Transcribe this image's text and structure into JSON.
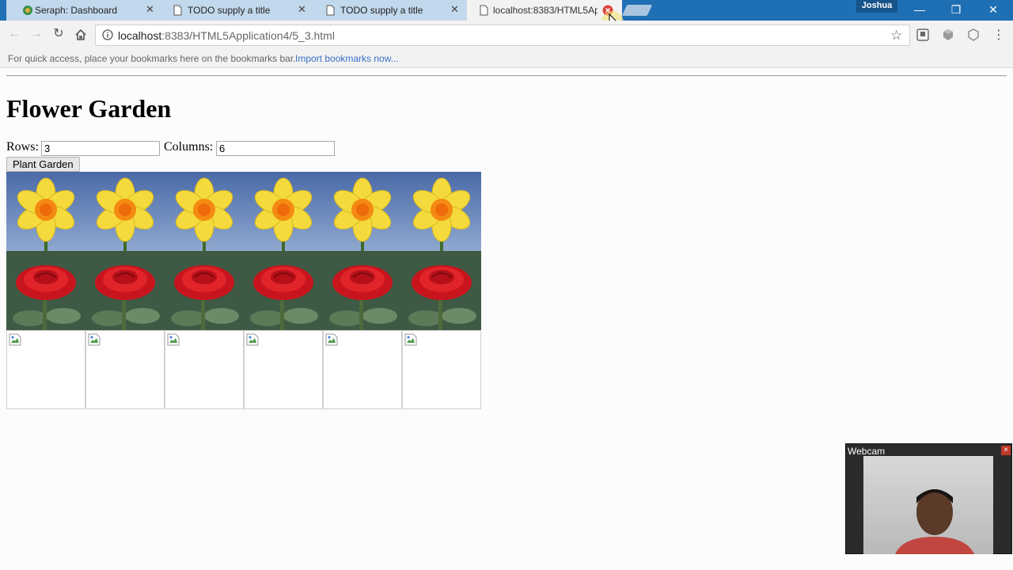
{
  "browser": {
    "tabs": [
      {
        "title": "Seraph: Dashboard",
        "active": false
      },
      {
        "title": "TODO supply a title",
        "active": false
      },
      {
        "title": "TODO supply a title",
        "active": false
      },
      {
        "title": "localhost:8383/HTML5Ap",
        "active": true
      }
    ],
    "profile_name": "Joshua",
    "url_host": "localhost",
    "url_rest": ":8383/HTML5Application4/5_3.html",
    "bookmarks_hint": "For quick access, place your bookmarks here on the bookmarks bar.",
    "bookmarks_import": "Import bookmarks now...",
    "colors": {
      "titlebar": "#1f6fb5",
      "tab_inactive": "#c2d8ec",
      "tab_active": "#f2f2f2",
      "link": "#3b6fc8"
    }
  },
  "page": {
    "title": "Flower Garden",
    "rows_label": "Rows:",
    "rows_value": "3",
    "columns_label": "Columns:",
    "columns_value": "6",
    "plant_button": "Plant Garden",
    "garden": {
      "rows": [
        "daffodil",
        "rose",
        "broken-image"
      ],
      "columns": 6
    }
  },
  "webcam": {
    "label": "Webcam",
    "close": "×"
  }
}
